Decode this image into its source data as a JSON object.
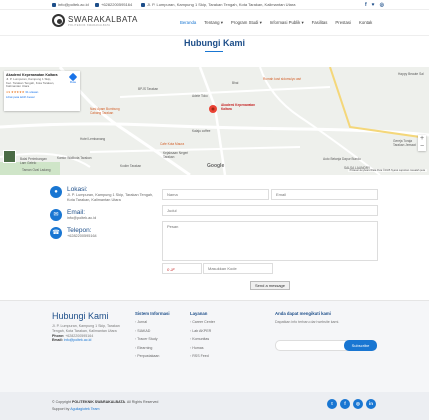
{
  "topbar": {
    "email": "info@poltek.ac.id",
    "phone": "+6282200595164",
    "address": "Jl. P. Lumpuran, Kampung 1 Skip, Tarakan Tengah, Kota Tarakan, Kalimantan Utara",
    "social": [
      "f",
      "♥",
      "◎"
    ]
  },
  "brand": {
    "logo_text": "SWARAKALBATA",
    "logo_sub": "POLITEKNIK SWARAKALBATA"
  },
  "nav": {
    "items": [
      "Beranda",
      "Tentang ▾",
      "Program Studi ▾",
      "Informasi Publik ▾",
      "Fasilitas",
      "Prestasi",
      "Kontak"
    ]
  },
  "page": {
    "title": "Hubungi Kami"
  },
  "map": {
    "card_name": "Akademi Keperawatan Kaltara",
    "card_address": "Jl. P. Lumpuran, Kampung 1 Skip, Kec. Tarakan Tengah, Kota Tarakan, Kalimantan Utara",
    "card_rating": "4.9 ★★★★★",
    "card_reviews": "31 ulasan",
    "card_link": "Lihat peta lebih besar",
    "directions": "Rute",
    "pin_label": "Akademi Keperawatan Kaltara",
    "places": {
      "happy_beaute": "Happy Beaute Sal",
      "rumah_kost": "Rumah kost sidomulyo asri",
      "bpjs": "BPJS Tarakan",
      "bhai": "Bhai",
      "adele": "Adele Toko",
      "nasi_babat": "Nasi Ayam Bumbung Cabang Tarakan",
      "kalaju": "Kalaju coffee",
      "hotel": "Hotel Lembanang",
      "cafe": "Cafe Kota Maura",
      "kejaksaan": "Kejaksaan Negeri Tarakan",
      "kantor": "Kantor Walikota Tarakan",
      "kodim": "Kodim Tarakan",
      "balai": "Balai Perimbangan Lam Gelelo",
      "taman": "Taman Oval Ladang",
      "auto": "Auto Belanja Dapur Bundu",
      "gereja": "Gereja Toraja Tarakan Jemaat",
      "saudia": "SALSA LAUNDRY"
    },
    "google": "Google",
    "attribution": "Pintasan keyboard   Data Peta ©2025   Syarat   Laporkan masalah peta",
    "zoom_in": "+",
    "zoom_out": "−"
  },
  "contact": {
    "location_label": "Lokasi:",
    "location_value": "Jl. P. Lumpuran, Kampung 1 Skip, Tarakan Tengah, Kota Tarakan, Kalimantan Utara",
    "email_label": "Email:",
    "email_value": "info@poltek.ac.id",
    "phone_label": "Telepon:",
    "phone_value": "+6282200595164"
  },
  "form": {
    "name_placeholder": "Nama",
    "email_placeholder": "Email",
    "subject_placeholder": "Judul",
    "message_placeholder": "Pesan",
    "captcha_text": "0 JF",
    "code_placeholder": "Masukkan Kode",
    "send_label": "Send a message"
  },
  "footer": {
    "brand": "Hubungi Kami",
    "address": "Jl. P. Lumpuran, Kampung 1 Skip, Tarakan Tengah, Kota Tarakan, Kalimantan Utara",
    "phone_label": "Phone:",
    "phone_value": "+6282200595164",
    "email_label": "Email:",
    "email_value": "info@poltek.ac.id",
    "col1_title": "Sistem Informasi",
    "col1_items": [
      "Jurnal",
      "SIAKAD",
      "Tracer Study",
      "Elearning",
      "Perpustakaan"
    ],
    "col2_title": "Layanan",
    "col2_items": [
      "Career Center",
      "Lab AKPER",
      "Komunitas",
      "Humas",
      "RSS Feed"
    ],
    "news_title": "Anda dapat mengikuti kami",
    "news_text": "Dapatkan info terbaru dari website kami.",
    "subscribe_label": "Subscribe"
  },
  "copyright": {
    "line1_prefix": "© Copyright ",
    "line1_brand": "POLITEKNIK SWARAKALBATA",
    "line1_suffix": ". All Rights Reserved",
    "line2_prefix": "Support by ",
    "line2_link": "Aguilagiotek Team",
    "social": [
      "t",
      "f",
      "◎",
      "in"
    ]
  }
}
